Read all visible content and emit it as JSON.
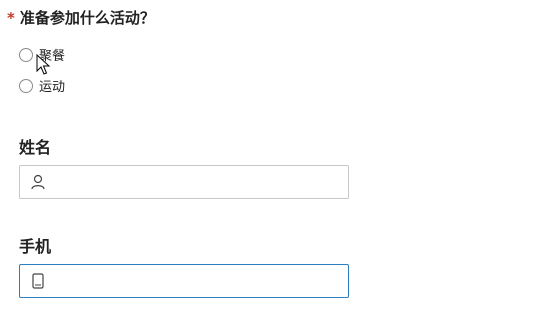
{
  "question": {
    "required_mark": "*",
    "text": "准备参加什么活动？",
    "options": [
      {
        "label": "聚餐",
        "selected": false
      },
      {
        "label": "运动",
        "selected": false
      }
    ]
  },
  "name_field": {
    "label": "姓名",
    "value": "",
    "icon": "person-icon"
  },
  "phone_field": {
    "label": "手机",
    "value": "",
    "icon": "phone-icon",
    "focused": true
  },
  "colors": {
    "required": "#c0392b",
    "focus_border": "#2b7fbf",
    "border": "#c8c8c8"
  }
}
